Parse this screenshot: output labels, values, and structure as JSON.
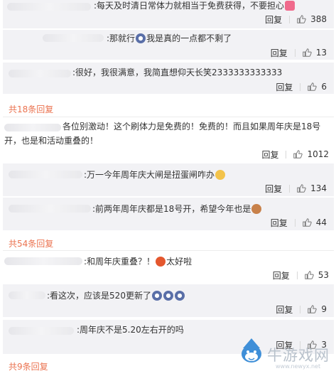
{
  "comments": [
    {
      "text": "每天及时清日常体力就相当于免费获得，不要担心",
      "reply_label": "回复",
      "likes": "388"
    },
    {
      "text": "那就行",
      "text_after": "我是真的一点都不剩了",
      "reply_label": "回复",
      "likes": "13"
    },
    {
      "text": "很好，我很满意，我简直想仰天长笑2333333333333",
      "reply_label": "回复",
      "likes": "6"
    },
    {
      "text": "万一今年周年庆大闸是扭蛋闸咋办",
      "reply_label": "回复",
      "likes": "134"
    },
    {
      "text": "前两年周年庆都是18号开，希望今年也是",
      "reply_label": "回复",
      "likes": "44"
    },
    {
      "text": "和周年庆重叠？！",
      "text_after": "太好啦",
      "reply_label": "回复",
      "likes": "53"
    },
    {
      "text": "看这次，应该是520更新了",
      "reply_label": "回复",
      "likes": "9"
    },
    {
      "text": "周年庆不是5.20左右开的吗",
      "reply_label": "回复",
      "likes": "3"
    }
  ],
  "main_post": {
    "text": "各位别激动！这个刷体力是免费的！免费的！而且如果周年庆是18号开，也是和活动重叠的！",
    "reply_label": "回复",
    "likes": "1012"
  },
  "more_links": [
    "共18条回复",
    "共54条回复",
    "共9条回复"
  ],
  "watermark": {
    "name": "牛游戏网",
    "url": "www.newyx.net"
  },
  "colors": {
    "link": "#eb7350",
    "reply_bg": "#f2f2f5",
    "text": "#333333"
  },
  "icons": {
    "like": "thumbs-up-icon",
    "emoji": "emoji-icon",
    "mascot": "shark-mascot-icon"
  }
}
